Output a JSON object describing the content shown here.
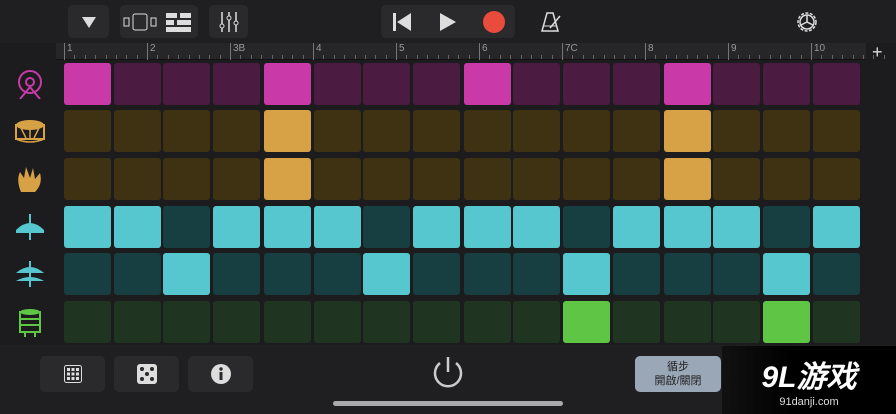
{
  "toolbar": {
    "buttons": [
      "browser-menu",
      "track-view",
      "sequencer-view",
      "mixer",
      "go-to-start",
      "play",
      "record",
      "metronome",
      "settings"
    ]
  },
  "ruler": {
    "bars": [
      "1",
      "2",
      "3B",
      "4",
      "5",
      "6",
      "7C",
      "8",
      "9",
      "10"
    ],
    "add": "+"
  },
  "instruments": [
    {
      "name": "kick",
      "icon": "kick-drum-icon",
      "on": "#c93aa8",
      "off": "#4b1b42"
    },
    {
      "name": "snare",
      "icon": "snare-drum-icon",
      "on": "#d6a245",
      "off": "#3e3213"
    },
    {
      "name": "clap",
      "icon": "clap-hand-icon",
      "on": "#d6a245",
      "off": "#3e3213"
    },
    {
      "name": "closed-hihat",
      "icon": "hihat-closed-icon",
      "on": "#56c7cf",
      "off": "#173e40"
    },
    {
      "name": "open-hihat",
      "icon": "hihat-open-icon",
      "on": "#56c7cf",
      "off": "#173e40"
    },
    {
      "name": "tom",
      "icon": "tom-drum-icon",
      "on": "#5ec545",
      "off": "#203521"
    }
  ],
  "pattern": [
    [
      1,
      0,
      0,
      0,
      1,
      0,
      0,
      0,
      1,
      0,
      0,
      0,
      1,
      0,
      0,
      0
    ],
    [
      0,
      0,
      0,
      0,
      1,
      0,
      0,
      0,
      0,
      0,
      0,
      0,
      1,
      0,
      0,
      0
    ],
    [
      0,
      0,
      0,
      0,
      1,
      0,
      0,
      0,
      0,
      0,
      0,
      0,
      1,
      0,
      0,
      0
    ],
    [
      1,
      1,
      0,
      1,
      1,
      1,
      0,
      1,
      1,
      1,
      0,
      1,
      1,
      1,
      0,
      1
    ],
    [
      0,
      0,
      1,
      0,
      0,
      0,
      1,
      0,
      0,
      0,
      1,
      0,
      0,
      0,
      1,
      0
    ],
    [
      0,
      0,
      0,
      0,
      0,
      0,
      0,
      0,
      0,
      0,
      1,
      0,
      0,
      0,
      1,
      0
    ]
  ],
  "bottom": {
    "loop_line1": "循步",
    "loop_line2": "開啟/關閉"
  },
  "watermark": {
    "logo": "9L游戏",
    "url": "91danji.com"
  }
}
